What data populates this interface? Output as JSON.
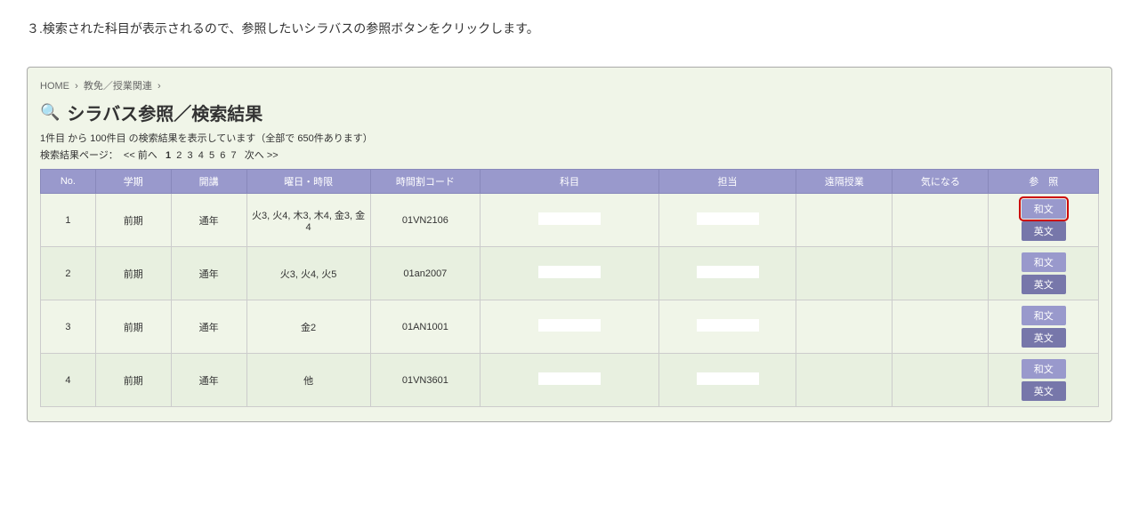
{
  "instruction": "３.検索された科目が表示されるので、参照したいシラバスの参照ボタンをクリックします。",
  "breadcrumb": {
    "items": [
      "HOME",
      "教免／授業関連"
    ]
  },
  "page_title": "シラバス参照／検索結果",
  "result_info": "1件目 から 100件目 の検索結果を表示しています（全部で 650件あります）",
  "pagination": {
    "prev": "<< 前へ",
    "pages": [
      "1",
      "2",
      "3",
      "4",
      "5",
      "6",
      "7"
    ],
    "current": "1",
    "next": "次へ >>"
  },
  "table": {
    "headers": [
      "No.",
      "学期",
      "開講",
      "曜日・時限",
      "時間割コード",
      "科目",
      "担当",
      "遠隔授業",
      "気になる",
      "参　照"
    ],
    "rows": [
      {
        "no": "1",
        "gakki": "前期",
        "kogi": "通年",
        "youbi": "火3, 火4, 木3, 木4, 金3, 金4",
        "code": "01VN2106",
        "kamoku": "",
        "tanto": "",
        "enkaku": "",
        "ki": "",
        "btn_wabun": "和文",
        "btn_eibun": "英文",
        "highlighted": true
      },
      {
        "no": "2",
        "gakki": "前期",
        "kogi": "通年",
        "youbi": "火3, 火4, 火5",
        "code": "01an2007",
        "kamoku": "",
        "tanto": "",
        "enkaku": "",
        "ki": "",
        "btn_wabun": "和文",
        "btn_eibun": "英文",
        "highlighted": false
      },
      {
        "no": "3",
        "gakki": "前期",
        "kogi": "通年",
        "youbi": "金2",
        "code": "01AN1001",
        "kamoku": "",
        "tanto": "",
        "enkaku": "",
        "ki": "",
        "btn_wabun": "和文",
        "btn_eibun": "英文",
        "highlighted": false
      },
      {
        "no": "4",
        "gakki": "前期",
        "kogi": "通年",
        "youbi": "他",
        "code": "01VN3601",
        "kamoku": "",
        "tanto": "",
        "enkaku": "",
        "ki": "",
        "btn_wabun": "和文",
        "btn_eibun": "英文",
        "highlighted": false
      }
    ]
  },
  "search_icon": "🔍"
}
